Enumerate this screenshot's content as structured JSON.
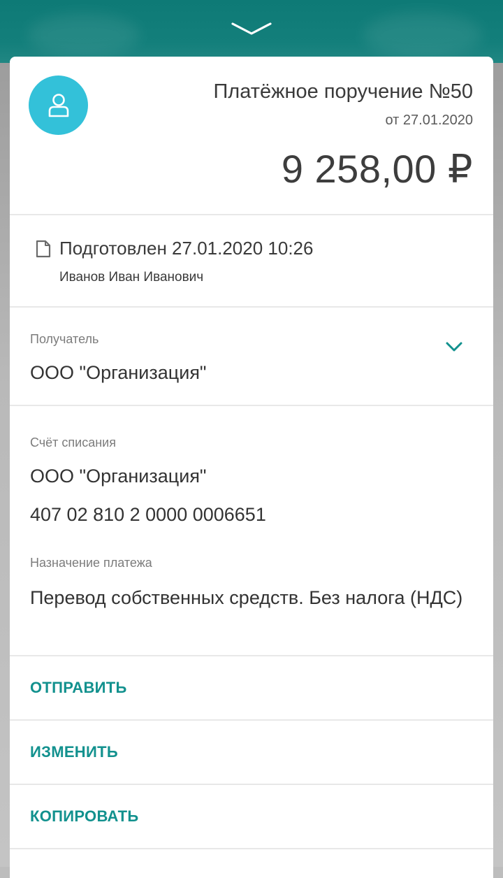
{
  "header": {
    "collapse_icon": "chevron-down-icon"
  },
  "document": {
    "avatar_icon": "user-icon",
    "title": "Платёжное поручение №50",
    "date": "от 27.01.2020",
    "amount": "9 258,00 ₽"
  },
  "status": {
    "icon": "document-icon",
    "text": "Подготовлен 27.01.2020 10:26",
    "author": "Иванов Иван Иванович"
  },
  "recipient": {
    "label": "Получатель",
    "value": "ООО \"Организация\"",
    "expand_icon": "chevron-down-icon"
  },
  "debit_account": {
    "label": "Счёт списания",
    "name": "ООО \"Организация\"",
    "number": "407 02 810 2 0000 0006651"
  },
  "purpose": {
    "label": "Назначение платежа",
    "value": "Перевод собственных средств. Без налога (НДС)"
  },
  "actions": {
    "send": "ОТПРАВИТЬ",
    "edit": "ИЗМЕНИТЬ",
    "copy": "КОПИРОВАТЬ"
  },
  "colors": {
    "header_teal": "#137f7b",
    "accent_teal": "#12918e",
    "avatar_cyan": "#33c1d9"
  }
}
